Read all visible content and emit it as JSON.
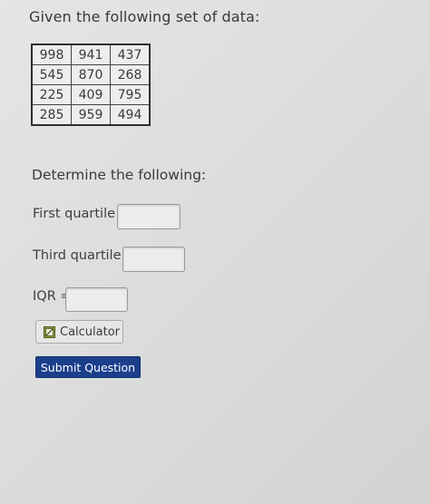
{
  "question": {
    "prompt": "Given the following set of data:",
    "table": [
      [
        "998",
        "941",
        "437"
      ],
      [
        "545",
        "870",
        "268"
      ],
      [
        "225",
        "409",
        "795"
      ],
      [
        "285",
        "959",
        "494"
      ]
    ],
    "instruction": "Determine the following:"
  },
  "fields": {
    "first_quartile": {
      "label": "First quartile =",
      "value": ""
    },
    "third_quartile": {
      "label": "Third quartile =",
      "value": ""
    },
    "iqr": {
      "label": "IQR =",
      "value": ""
    }
  },
  "buttons": {
    "calculator_label": "Calculator",
    "calculator_icon": "calculator-icon",
    "submit_label": "Submit Question",
    "submit_color": "#1c3f8c"
  }
}
